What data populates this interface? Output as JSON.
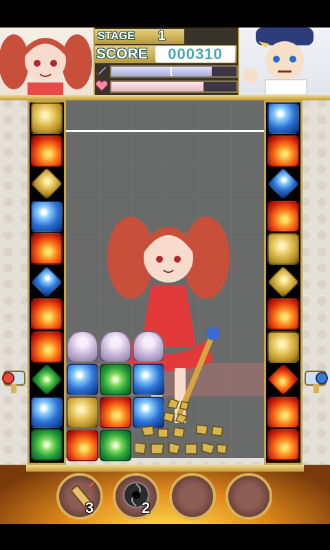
{
  "hud": {
    "stage_label": "STAGE",
    "stage_value": "1",
    "score_label": "SCORE",
    "score_value": "000310",
    "attack_gauge": 0.82,
    "life_gauge": 0.75
  },
  "colors": {
    "gold": "#c9a54a",
    "playfield": "#696a6a",
    "score_text": "#4aa7b0",
    "fire": "#d21a0a",
    "water": "#2c74d4",
    "wind": "#27a13b",
    "earth": "#b58c22"
  },
  "left_column_gems": [
    "earth",
    "fire",
    "earth",
    "water",
    "fire",
    "water",
    "fire",
    "fire",
    "wind",
    "water",
    "wind"
  ],
  "right_column_gems": [
    "water",
    "fire",
    "water",
    "fire",
    "earth",
    "earth",
    "fire",
    "earth",
    "fire",
    "fire",
    "fire"
  ],
  "items": [
    {
      "icon": "dynamite-icon",
      "count": "3"
    },
    {
      "icon": "black-hole-icon",
      "count": "2"
    },
    {
      "icon": "empty-slot",
      "count": ""
    },
    {
      "icon": "empty-slot",
      "count": ""
    }
  ]
}
